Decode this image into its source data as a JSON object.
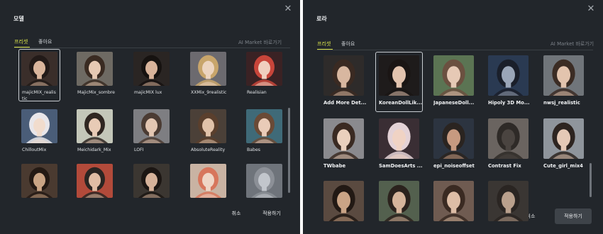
{
  "left": {
    "title": "모델",
    "tabs": [
      {
        "label": "프리셋",
        "active": true
      },
      {
        "label": "좋아요",
        "active": false
      }
    ],
    "market_link": "AI Market 바로가기",
    "tiles": [
      {
        "label": "majicMIX_realis",
        "label2": "tic",
        "selected": true,
        "theme": "#3a2e2a",
        "skin": "#d9b59c",
        "hair": "#221a18"
      },
      {
        "label": "MajicMix_sombre",
        "selected": false,
        "theme": "#6e6a63",
        "skin": "#e6c9b3",
        "hair": "#3a2b22"
      },
      {
        "label": "majicMIX lux",
        "selected": false,
        "theme": "#2a2523",
        "skin": "#d8b39a",
        "hair": "#161210"
      },
      {
        "label": "XXMix_9realistic",
        "selected": false,
        "theme": "#6c6a6f",
        "skin": "#ecd4bf",
        "hair": "#c8a56b"
      },
      {
        "label": "Realisian",
        "selected": false,
        "theme": "#3a2224",
        "skin": "#f0cfbf",
        "hair": "#c8453a"
      },
      {
        "label": "ChilloutMix",
        "selected": false,
        "theme": "#4a5d78",
        "skin": "#f1dccd",
        "hair": "#e8e6ea"
      },
      {
        "label": "Meichidark_Mix",
        "selected": false,
        "theme": "#c4c7b9",
        "skin": "#e8cbb6",
        "hair": "#2f2621"
      },
      {
        "label": "LOFI",
        "selected": false,
        "theme": "#7e7e82",
        "skin": "#e3c6b2",
        "hair": "#4b3b33"
      },
      {
        "label": "AbsoluteReality",
        "selected": false,
        "theme": "#4b4038",
        "skin": "#e1c2a9",
        "hair": "#5a3f2d"
      },
      {
        "label": "Babes",
        "selected": false,
        "theme": "#3f6a78",
        "skin": "#e9cbb8",
        "hair": "#6a4a36"
      },
      {
        "label": "",
        "selected": false,
        "theme": "#4a3a30",
        "skin": "#caa585",
        "hair": "#241a14"
      },
      {
        "label": "",
        "selected": false,
        "theme": "#b24a3a",
        "skin": "#e0bda4",
        "hair": "#2a2522"
      },
      {
        "label": "",
        "selected": false,
        "theme": "#3b3631",
        "skin": "#d6b29a",
        "hair": "#1c1613"
      },
      {
        "label": "",
        "selected": false,
        "theme": "#c9b3a3",
        "skin": "#efd6c6",
        "hair": "#d7765c"
      },
      {
        "label": "",
        "selected": false,
        "theme": "#6f747b",
        "skin": "#c2c6cc",
        "hair": "#8c9097"
      }
    ],
    "cancel_label": "취소",
    "apply_label": "적용하기"
  },
  "right": {
    "title": "로라",
    "tabs": [
      {
        "label": "프리셋",
        "active": true
      },
      {
        "label": "좋아요",
        "active": false
      }
    ],
    "market_link": "AI Market 바로가기",
    "tiles": [
      {
        "label": "Add More Det...",
        "selected": false,
        "theme": "#2e2b2a",
        "skin": "#d8b7a0",
        "hair": "#3a2a22"
      },
      {
        "label": "KoreanDollLik...",
        "selected": true,
        "theme": "#1e1b1b",
        "skin": "#e2c3ae",
        "hair": "#1a1514"
      },
      {
        "label": "JapaneseDoll...",
        "selected": false,
        "theme": "#5b7453",
        "skin": "#e6c9b5",
        "hair": "#6b5040"
      },
      {
        "label": "Hipoly 3D Mo...",
        "selected": false,
        "theme": "#2a3a52",
        "skin": "#9aa6b8",
        "hair": "#1a1f2a"
      },
      {
        "label": "nwsj_realistic",
        "selected": false,
        "theme": "#70757a",
        "skin": "#e3c4ae",
        "hair": "#3b2c24"
      },
      {
        "label": "TWbabe",
        "selected": false,
        "theme": "#8a8a8e",
        "skin": "#ead0bd",
        "hair": "#3a2a22"
      },
      {
        "label": "SamDoesArts ...",
        "selected": false,
        "theme": "#3a2e34",
        "skin": "#f0d3c4",
        "hair": "#e4d2d6"
      },
      {
        "label": "epi_noiseoffset",
        "selected": false,
        "theme": "#2c3440",
        "skin": "#c79a80",
        "hair": "#2a2420"
      },
      {
        "label": "Contrast Fix",
        "selected": false,
        "theme": "#6a6460",
        "skin": "#4a4440",
        "hair": "#2e2a27"
      },
      {
        "label": "Cute_girl_mix4",
        "selected": false,
        "theme": "#8f959c",
        "skin": "#e5c9b6",
        "hair": "#2d2420"
      },
      {
        "label": "",
        "selected": false,
        "theme": "#5a4a40",
        "skin": "#caa486",
        "hair": "#221914"
      },
      {
        "label": "",
        "selected": false,
        "theme": "#53604e",
        "skin": "#d6b49b",
        "hair": "#2b221d"
      },
      {
        "label": "",
        "selected": false,
        "theme": "#6f5b51",
        "skin": "#ddbda6",
        "hair": "#3a2a22"
      },
      {
        "label": "",
        "selected": false,
        "theme": "#3a3633",
        "skin": "#b9a08c",
        "hair": "#2a2522"
      }
    ],
    "cancel_label": "취소",
    "apply_label": "적용하기"
  }
}
